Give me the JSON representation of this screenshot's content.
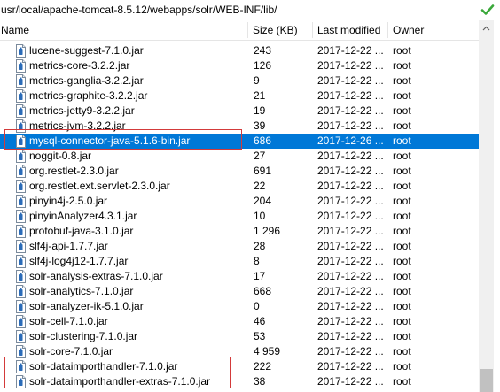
{
  "path": {
    "value": "usr/local/apache-tomcat-8.5.12/webapps/solr/WEB-INF/lib/"
  },
  "columns": {
    "name": "Name",
    "size": "Size (KB)",
    "modified": "Last modified",
    "owner": "Owner"
  },
  "files": [
    {
      "name": "lucene-suggest-7.1.0.jar",
      "size": "243",
      "modified": "2017-12-22 ...",
      "owner": "root"
    },
    {
      "name": "metrics-core-3.2.2.jar",
      "size": "126",
      "modified": "2017-12-22 ...",
      "owner": "root"
    },
    {
      "name": "metrics-ganglia-3.2.2.jar",
      "size": "9",
      "modified": "2017-12-22 ...",
      "owner": "root"
    },
    {
      "name": "metrics-graphite-3.2.2.jar",
      "size": "21",
      "modified": "2017-12-22 ...",
      "owner": "root"
    },
    {
      "name": "metrics-jetty9-3.2.2.jar",
      "size": "19",
      "modified": "2017-12-22 ...",
      "owner": "root"
    },
    {
      "name": "metrics-jvm-3.2.2.jar",
      "size": "39",
      "modified": "2017-12-22 ...",
      "owner": "root"
    },
    {
      "name": "mysql-connector-java-5.1.6-bin.jar",
      "size": "686",
      "modified": "2017-12-26 ...",
      "owner": "root"
    },
    {
      "name": "noggit-0.8.jar",
      "size": "27",
      "modified": "2017-12-22 ...",
      "owner": "root"
    },
    {
      "name": "org.restlet-2.3.0.jar",
      "size": "691",
      "modified": "2017-12-22 ...",
      "owner": "root"
    },
    {
      "name": "org.restlet.ext.servlet-2.3.0.jar",
      "size": "22",
      "modified": "2017-12-22 ...",
      "owner": "root"
    },
    {
      "name": "pinyin4j-2.5.0.jar",
      "size": "204",
      "modified": "2017-12-22 ...",
      "owner": "root"
    },
    {
      "name": "pinyinAnalyzer4.3.1.jar",
      "size": "10",
      "modified": "2017-12-22 ...",
      "owner": "root"
    },
    {
      "name": "protobuf-java-3.1.0.jar",
      "size": "1 296",
      "modified": "2017-12-22 ...",
      "owner": "root"
    },
    {
      "name": "slf4j-api-1.7.7.jar",
      "size": "28",
      "modified": "2017-12-22 ...",
      "owner": "root"
    },
    {
      "name": "slf4j-log4j12-1.7.7.jar",
      "size": "8",
      "modified": "2017-12-22 ...",
      "owner": "root"
    },
    {
      "name": "solr-analysis-extras-7.1.0.jar",
      "size": "17",
      "modified": "2017-12-22 ...",
      "owner": "root"
    },
    {
      "name": "solr-analytics-7.1.0.jar",
      "size": "668",
      "modified": "2017-12-22 ...",
      "owner": "root"
    },
    {
      "name": "solr-analyzer-ik-5.1.0.jar",
      "size": "0",
      "modified": "2017-12-22 ...",
      "owner": "root"
    },
    {
      "name": "solr-cell-7.1.0.jar",
      "size": "46",
      "modified": "2017-12-22 ...",
      "owner": "root"
    },
    {
      "name": "solr-clustering-7.1.0.jar",
      "size": "53",
      "modified": "2017-12-22 ...",
      "owner": "root"
    },
    {
      "name": "solr-core-7.1.0.jar",
      "size": "4 959",
      "modified": "2017-12-22 ...",
      "owner": "root"
    },
    {
      "name": "solr-dataimporthandler-7.1.0.jar",
      "size": "222",
      "modified": "2017-12-22 ...",
      "owner": "root"
    },
    {
      "name": "solr-dataimporthandler-extras-7.1.0.jar",
      "size": "38",
      "modified": "2017-12-22 ...",
      "owner": "root"
    }
  ],
  "selected_file": "mysql-connector-java-5.1.6-bin.jar",
  "highlighted_files": [
    "mysql-connector-java-5.1.6-bin.jar",
    "solr-dataimporthandler-7.1.0.jar",
    "solr-dataimporthandler-extras-7.1.0.jar"
  ],
  "colors": {
    "selection": "#0078d7",
    "highlight_border": "#d33a3a",
    "check": "#3aa83a"
  },
  "icons": {
    "file": "jar-file-icon",
    "confirm": "check-icon",
    "scroll": "chevron-up-icon"
  }
}
